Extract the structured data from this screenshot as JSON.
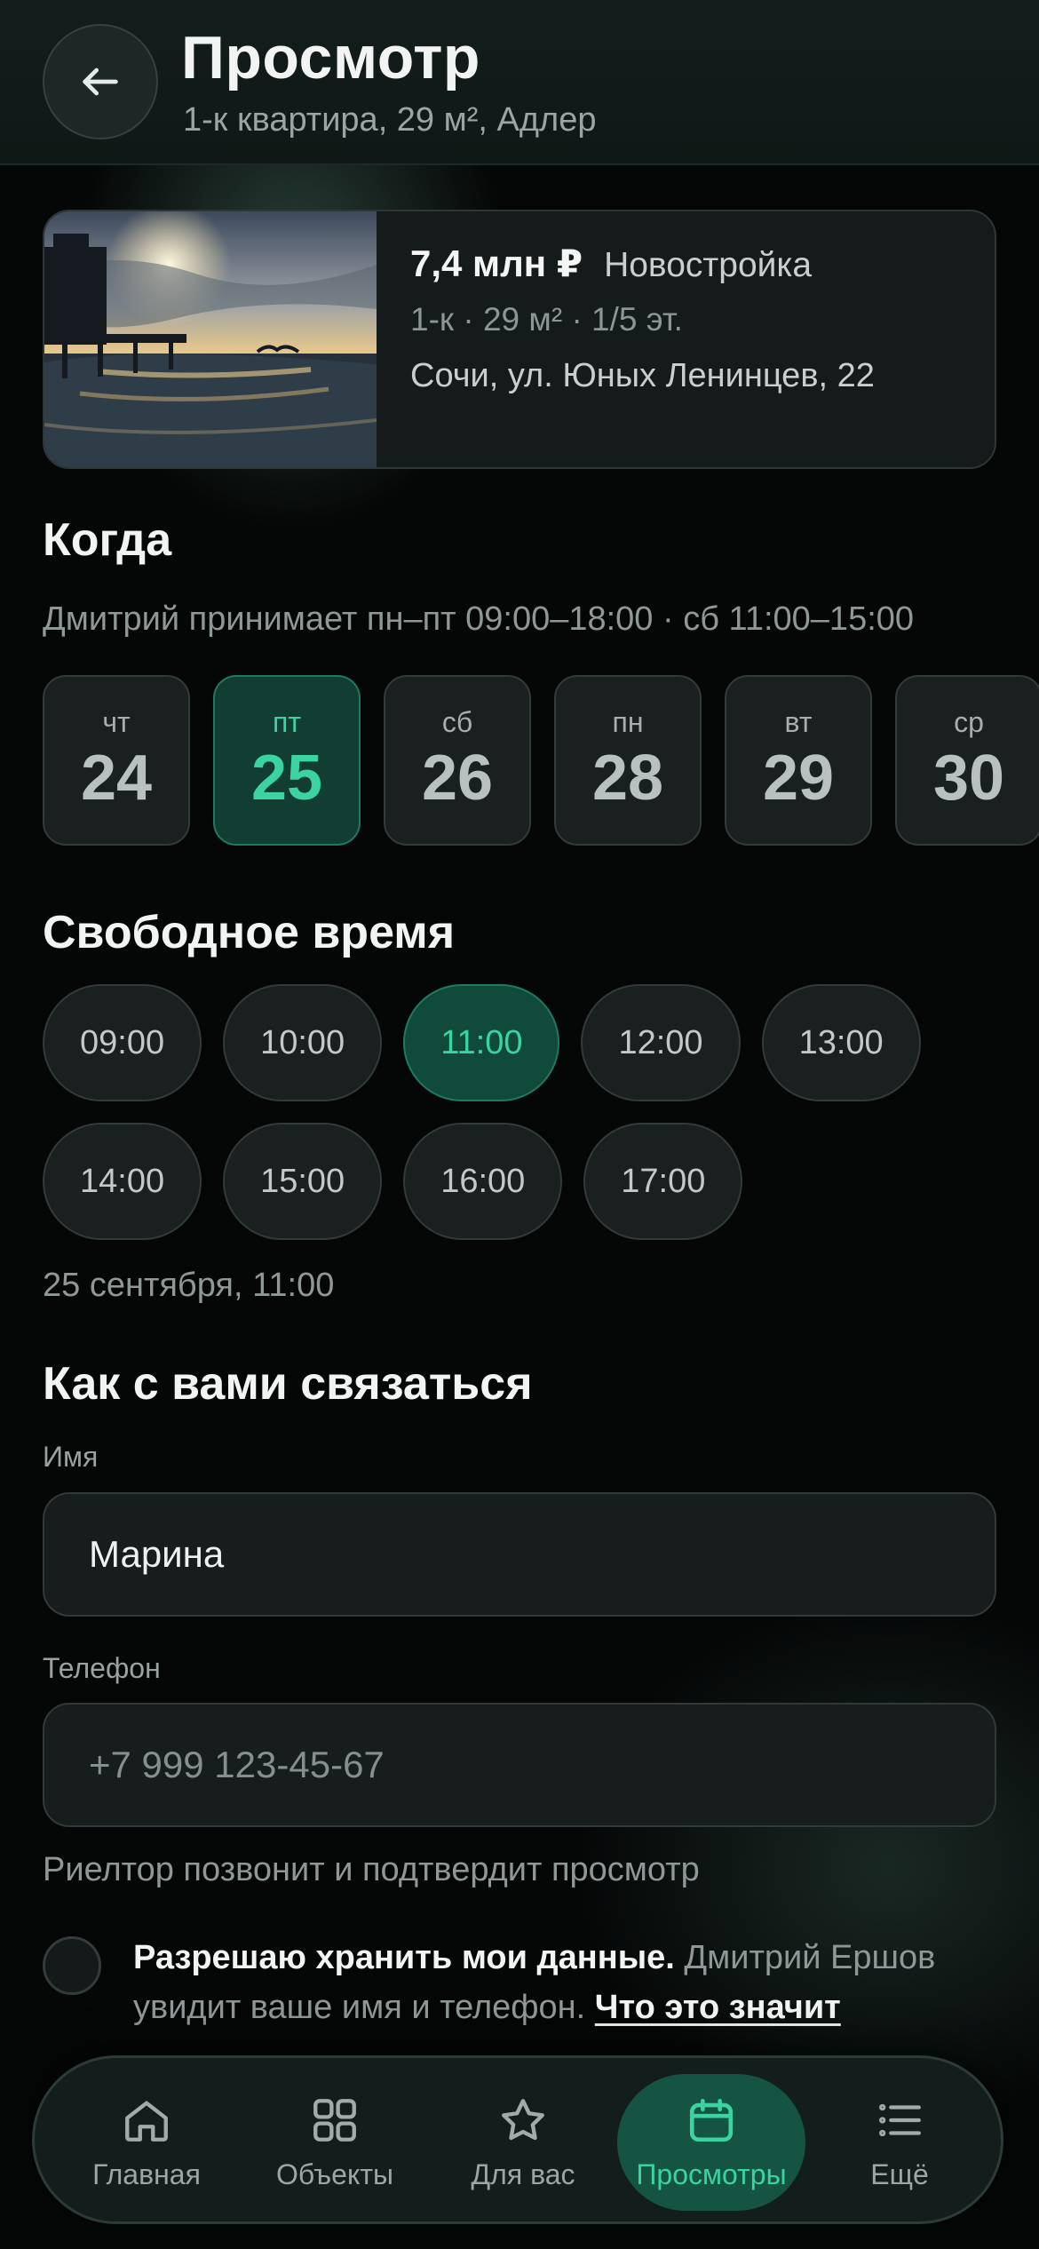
{
  "header": {
    "title": "Просмотр",
    "subtitle": "1-к квартира, 29 м², Адлер"
  },
  "listing": {
    "price": "7,4 млн ₽",
    "type": "Новостройка",
    "params": "1-к · 29 м² · 1/5 эт.",
    "address": "Сочи, ул. Юных Ленинцев, 22"
  },
  "when": {
    "title": "Когда",
    "hint": "Дмитрий принимает пн–пт 09:00–18:00 · сб 11:00–15:00",
    "dates": [
      {
        "dow": "чт",
        "day": "24"
      },
      {
        "dow": "пт",
        "day": "25"
      },
      {
        "dow": "сб",
        "day": "26"
      },
      {
        "dow": "пн",
        "day": "28"
      },
      {
        "dow": "вт",
        "day": "29"
      },
      {
        "dow": "ср",
        "day": "30"
      }
    ],
    "selected_date_index": 1
  },
  "free_time": {
    "title": "Свободное время",
    "slots": [
      "09:00",
      "10:00",
      "11:00",
      "12:00",
      "13:00",
      "14:00",
      "15:00",
      "16:00",
      "17:00"
    ],
    "selected_slot_index": 2,
    "selection_summary": "25 сентября, 11:00"
  },
  "contact": {
    "title": "Как с вами связаться",
    "name_label": "Имя",
    "name_value": "Марина",
    "phone_label": "Телефон",
    "phone_placeholder": "+7 999 123-45-67",
    "phone_hint": "Риелтор позвонит и подтвердит просмотр"
  },
  "consent": {
    "bold": "Разрешаю хранить мои данные.",
    "text": "Дмитрий Ершов увидит ваше имя и телефон.",
    "link": "Что это значит",
    "checked": false
  },
  "tabbar": {
    "items": [
      {
        "label": "Главная",
        "icon": "home-icon"
      },
      {
        "label": "Объекты",
        "icon": "grid-icon"
      },
      {
        "label": "Для вас",
        "icon": "star-icon"
      },
      {
        "label": "Просмотры",
        "icon": "calendar-icon"
      },
      {
        "label": "Ещё",
        "icon": "list-icon"
      }
    ],
    "active_index": 3
  },
  "colors": {
    "accent": "#3CD3A2",
    "accent_bg": "#113D32",
    "background": "#050707"
  }
}
